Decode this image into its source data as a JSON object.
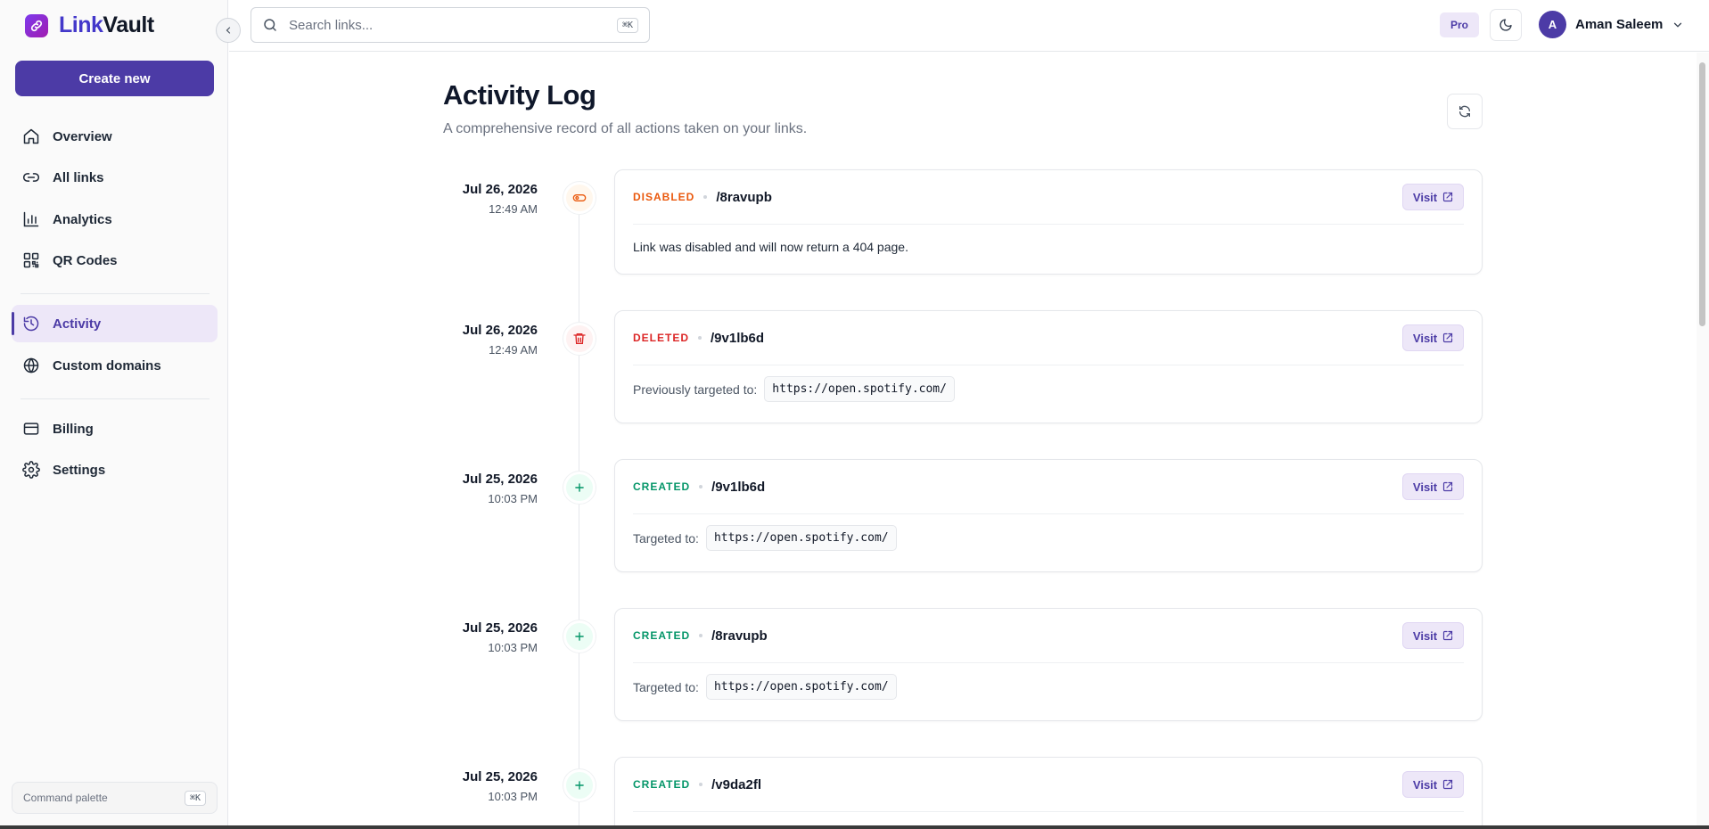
{
  "app": {
    "logo_prefix": "Link",
    "logo_suffix": "Vault",
    "colors": {
      "primary": "#4c3ba6",
      "disabled": "#ea580c",
      "deleted": "#dc2626",
      "created": "#059669"
    }
  },
  "sidebar": {
    "create_label": "Create new",
    "items": [
      {
        "label": "Overview",
        "icon": "home-icon"
      },
      {
        "label": "All links",
        "icon": "link-icon"
      },
      {
        "label": "Analytics",
        "icon": "bar-chart-icon"
      },
      {
        "label": "QR Codes",
        "icon": "qr-code-icon"
      },
      {
        "label": "Activity",
        "icon": "history-icon",
        "active": true
      },
      {
        "label": "Custom domains",
        "icon": "globe-icon"
      },
      {
        "label": "Billing",
        "icon": "credit-card-icon"
      },
      {
        "label": "Settings",
        "icon": "gear-icon"
      }
    ],
    "command_palette": {
      "label": "Command palette",
      "shortcut": "⌘K"
    }
  },
  "topbar": {
    "search": {
      "placeholder": "Search links...",
      "value": "",
      "shortcut": "⌘K"
    },
    "plan_badge": "Pro",
    "user": {
      "initial": "A",
      "name": "Aman Saleem"
    }
  },
  "page": {
    "title": "Activity Log",
    "subtitle": "A comprehensive record of all actions taken on your links."
  },
  "activity": [
    {
      "date": "Jul 26, 2026",
      "time": "12:49 AM",
      "action": "DISABLED",
      "slug": "/8ravupb",
      "visit": "Visit",
      "message": "Link was disabled and will now return a 404 page."
    },
    {
      "date": "Jul 26, 2026",
      "time": "12:49 AM",
      "action": "DELETED",
      "slug": "/9v1lb6d",
      "visit": "Visit",
      "label": "Previously targeted to:",
      "url": "https://open.spotify.com/"
    },
    {
      "date": "Jul 25, 2026",
      "time": "10:03 PM",
      "action": "CREATED",
      "slug": "/9v1lb6d",
      "visit": "Visit",
      "label": "Targeted to:",
      "url": "https://open.spotify.com/"
    },
    {
      "date": "Jul 25, 2026",
      "time": "10:03 PM",
      "action": "CREATED",
      "slug": "/8ravupb",
      "visit": "Visit",
      "label": "Targeted to:",
      "url": "https://open.spotify.com/"
    },
    {
      "date": "Jul 25, 2026",
      "time": "10:03 PM",
      "action": "CREATED",
      "slug": "/v9da2fl",
      "visit": "Visit"
    }
  ]
}
